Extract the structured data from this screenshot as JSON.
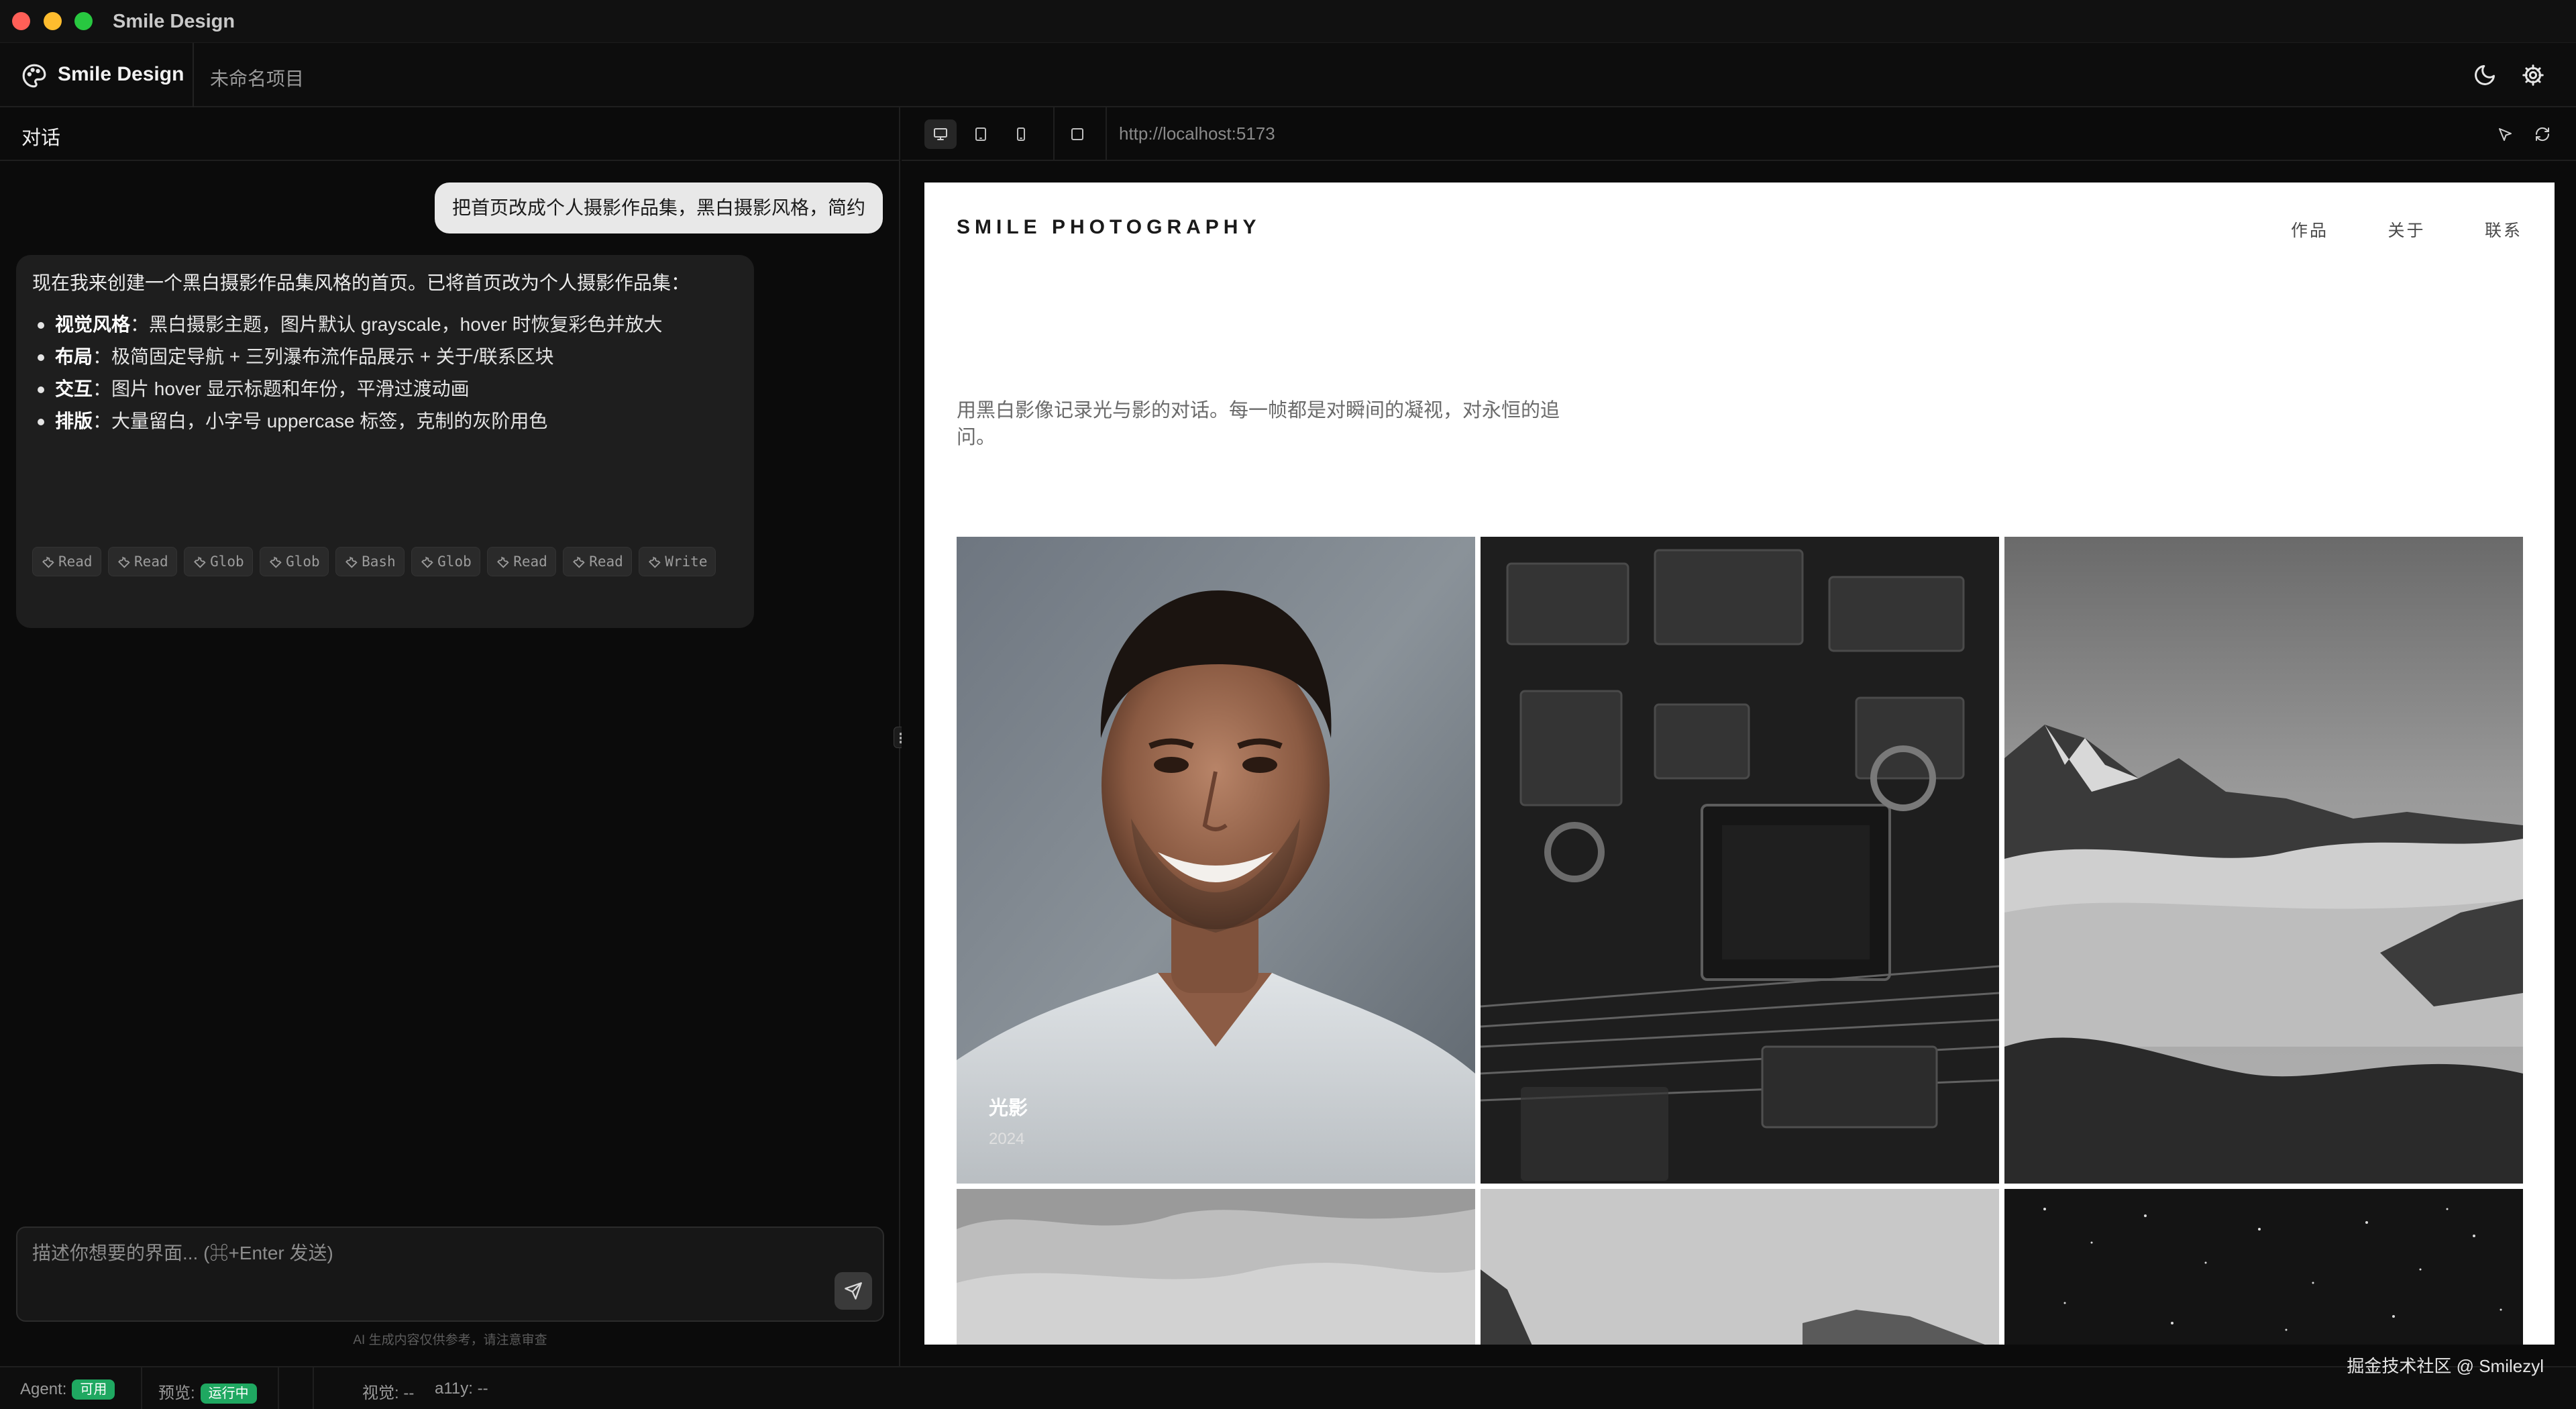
{
  "window": {
    "title": "Smile Design"
  },
  "header": {
    "brand": "Smile Design",
    "project": "未命名项目",
    "icons": [
      "palette-icon",
      "moon-icon",
      "gear-icon"
    ]
  },
  "chat": {
    "panel_title": "对话",
    "user_message": "把首页改成个人摄影作品集，黑白摄影风格，简约",
    "ai_intro": "现在我来创建一个黑白摄影作品集风格的首页。已将首页改为个人摄影作品集：",
    "ai_points": [
      {
        "label": "视觉风格",
        "text": "：黑白摄影主题，图片默认 grayscale，hover 时恢复彩色并放大"
      },
      {
        "label": "布局",
        "text": "：极简固定导航 + 三列瀑布流作品展示 + 关于/联系区块"
      },
      {
        "label": "交互",
        "text": "：图片 hover 显示标题和年份，平滑过渡动画"
      },
      {
        "label": "排版",
        "text": "：大量留白，小字号 uppercase 标签，克制的灰阶用色"
      }
    ],
    "tools": [
      "Read",
      "Read",
      "Glob",
      "Glob",
      "Bash",
      "Glob",
      "Read",
      "Read",
      "Write"
    ],
    "composer_placeholder": "描述你想要的界面... (⌘+Enter 发送)",
    "disclaimer": "AI 生成内容仅供参考，请注意审查"
  },
  "preview": {
    "url": "http://localhost:5173",
    "site": {
      "logo": "SMILE PHOTOGRAPHY",
      "nav": [
        "作品",
        "关于",
        "联系"
      ],
      "intro": "用黑白影像记录光与影的对话。每一帧都是对瞬间的凝视，对永恒的追问。",
      "photos": [
        {
          "title": "光影",
          "year": "2024"
        }
      ]
    }
  },
  "status": {
    "agent_label": "Agent:",
    "agent_badge": "可用",
    "preview_label": "预览:",
    "preview_badge": "运行中",
    "visual": "视觉: --",
    "a11y": "a11y: --",
    "accent": "#1fa861"
  },
  "watermark": "掘金技术社区 @ Smilezyl"
}
